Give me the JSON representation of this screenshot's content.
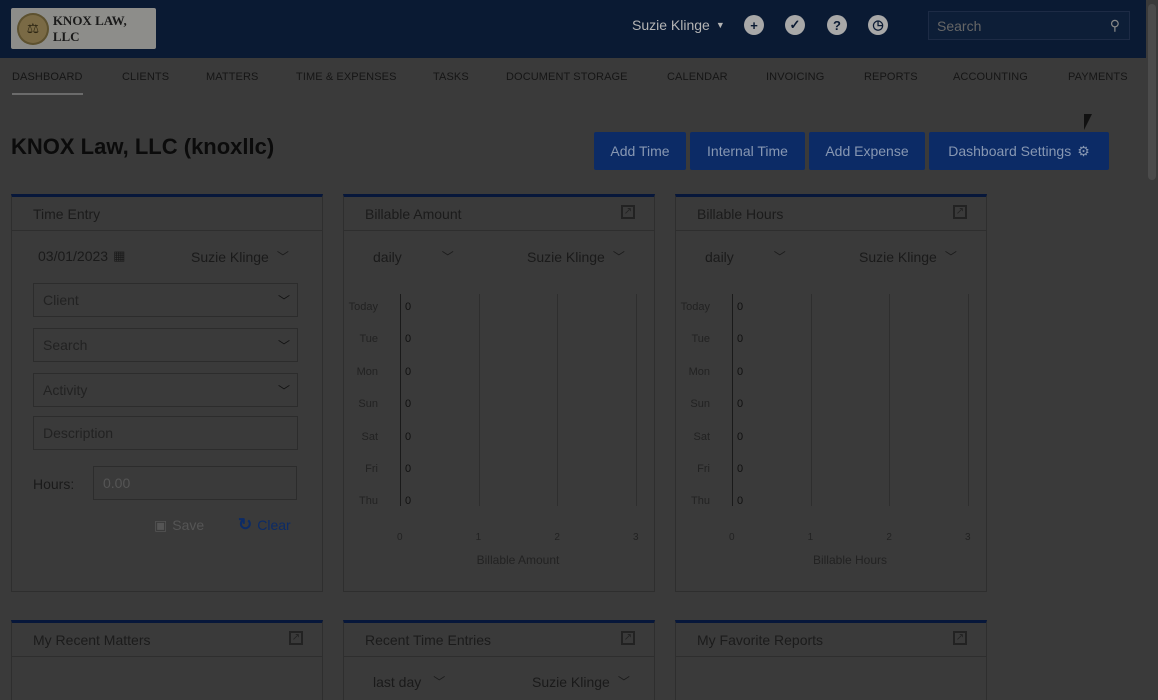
{
  "header": {
    "logo_text": "KNOX LAW, LLC",
    "user": "Suzie Klinge",
    "search_placeholder": "Search"
  },
  "nav": [
    "DASHBOARD",
    "CLIENTS",
    "MATTERS",
    "TIME & EXPENSES",
    "TASKS",
    "DOCUMENT STORAGE",
    "CALENDAR",
    "INVOICING",
    "REPORTS",
    "ACCOUNTING",
    "PAYMENTS"
  ],
  "page": {
    "title": "KNOX Law, LLC (knoxllc)",
    "buttons": [
      "Add Time",
      "Internal Time",
      "Add Expense",
      "Dashboard Settings"
    ]
  },
  "time_entry": {
    "title": "Time Entry",
    "date": "03/01/2023",
    "user": "Suzie Klinge",
    "client_placeholder": "Client",
    "search_placeholder": "Search",
    "activity_placeholder": "Activity",
    "description_placeholder": "Description",
    "hours_label": "Hours:",
    "hours_placeholder": "0.00",
    "save_label": "Save",
    "clear_label": "Clear"
  },
  "billable_amount": {
    "title": "Billable Amount",
    "period": "daily",
    "user": "Suzie Klinge"
  },
  "billable_hours": {
    "title": "Billable Hours",
    "period": "daily",
    "user": "Suzie Klinge"
  },
  "chart_data": [
    {
      "type": "bar",
      "categories": [
        "Today",
        "Tue",
        "Mon",
        "Sun",
        "Sat",
        "Fri",
        "Thu"
      ],
      "values": [
        0,
        0,
        0,
        0,
        0,
        0,
        0
      ],
      "xlabel": "Billable Amount",
      "xticks": [
        "0",
        "1",
        "2",
        "3"
      ],
      "xlim": [
        0,
        3
      ],
      "grid": true
    },
    {
      "type": "bar",
      "categories": [
        "Today",
        "Tue",
        "Mon",
        "Sun",
        "Sat",
        "Fri",
        "Thu"
      ],
      "values": [
        0,
        0,
        0,
        0,
        0,
        0,
        0
      ],
      "xlabel": "Billable Hours",
      "xticks": [
        "0",
        "1",
        "2",
        "3"
      ],
      "xlim": [
        0,
        3
      ],
      "grid": true
    }
  ],
  "recent_matters": {
    "title": "My Recent Matters"
  },
  "recent_time": {
    "title": "Recent Time Entries",
    "period": "last day",
    "user": "Suzie Klinge"
  },
  "favorite_reports": {
    "title": "My Favorite Reports"
  },
  "colors": {
    "navy": "#0a1a33",
    "button": "#0c2b66",
    "overlay": "#3a3a3a"
  }
}
